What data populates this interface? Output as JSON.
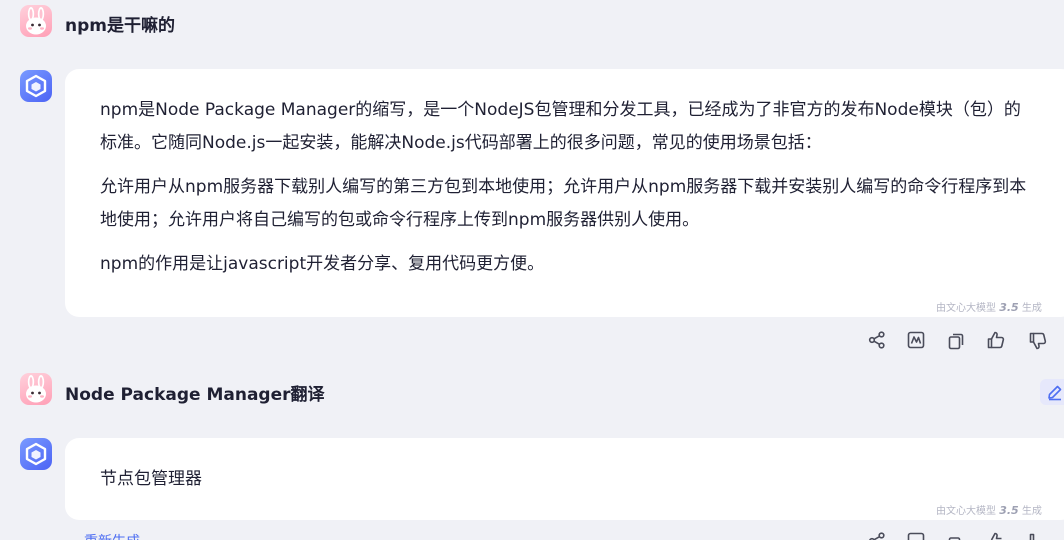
{
  "conversation": {
    "turn1": {
      "question": "npm是干嘛的",
      "answer_paragraphs": [
        "npm是Node Package Manager的缩写，是一个NodeJS包管理和分发工具，已经成为了非官方的发布Node模块（包）的标准。它随同Node.js一起安装，能解决Node.js代码部署上的很多问题，常见的使用场景包括：",
        "允许用户从npm服务器下载别人编写的第三方包到本地使用；允许用户从npm服务器下载并安装别人编写的命令行程序到本地使用；允许用户将自己编写的包或命令行程序上传到npm服务器供别人使用。",
        "npm的作用是让javascript开发者分享、复用代码更方便。"
      ],
      "gen_tag_prefix": "由文心大模型",
      "gen_tag_version": "3.5",
      "gen_tag_suffix": "生成"
    },
    "turn2": {
      "question": "Node Package Manager翻译",
      "answer": "节点包管理器",
      "gen_tag_prefix": "由文心大模型",
      "gen_tag_version": "3.5",
      "gen_tag_suffix": "生成",
      "regenerate_label": "重新生成"
    }
  },
  "icons": {
    "user_avatar": "bunny-avatar-icon",
    "bot_avatar": "wenxin-logo-icon",
    "actions": [
      "share-icon",
      "chart-icon",
      "copy-icon",
      "thumbs-up-icon",
      "thumbs-down-icon"
    ],
    "edit": "edit-pencil-icon"
  },
  "colors": {
    "page_bg": "#f0f1f6",
    "bubble_bg": "#ffffff",
    "accent": "#4e6ef2",
    "text": "#1f2033"
  }
}
